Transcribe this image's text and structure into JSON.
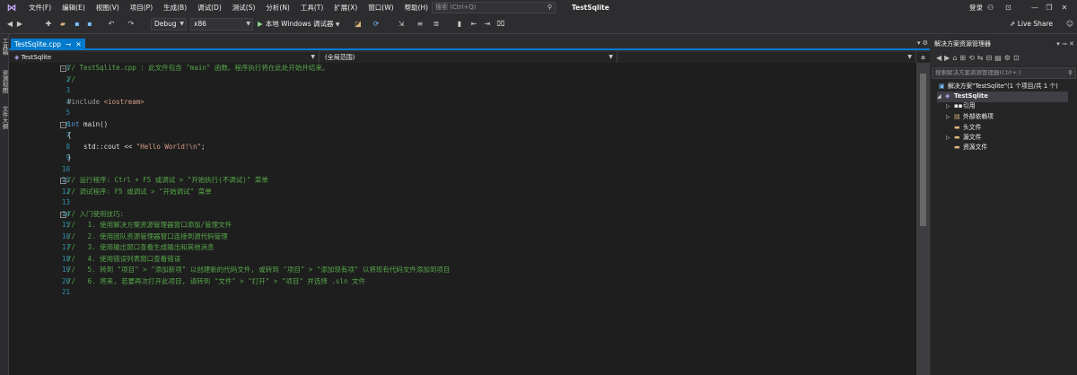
{
  "menu": {
    "items": [
      "文件(F)",
      "编辑(E)",
      "视图(V)",
      "项目(P)",
      "生成(B)",
      "调试(D)",
      "测试(S)",
      "分析(N)",
      "工具(T)",
      "扩展(X)",
      "窗口(W)",
      "帮助(H)"
    ],
    "search_placeholder": "搜索 (Ctrl+Q)",
    "window_title": "TestSqlite",
    "login": "登录"
  },
  "toolbar": {
    "config": "Debug",
    "platform": "x86",
    "start_label": "本地 Windows 调试器",
    "liveshare": "Live Share"
  },
  "left_strip": [
    "工具箱",
    "资源视图",
    "文件大纲"
  ],
  "editor": {
    "tab_label": "TestSqlite.cpp",
    "nav_project": "TestSqlite",
    "nav_scope": "(全局范围)",
    "line_numbers": [
      "1",
      "2",
      "3",
      "4",
      "5",
      "6",
      "7",
      "8",
      "9",
      "10",
      "11",
      "12",
      "13",
      "14",
      "15",
      "16",
      "17",
      "18",
      "19",
      "20",
      "21"
    ],
    "lines": [
      [
        {
          "c": "cmt",
          "t": "// TestSqlite.cpp : 此文件包含 \"main\" 函数。程序执行将在此处开始并结束。"
        }
      ],
      [
        {
          "c": "cmt",
          "t": "//"
        }
      ],
      [
        {
          "c": "txt",
          "t": ""
        }
      ],
      [
        {
          "c": "pp",
          "t": "#include "
        },
        {
          "c": "str",
          "t": "<iostream>"
        }
      ],
      [
        {
          "c": "txt",
          "t": ""
        }
      ],
      [
        {
          "c": "kw",
          "t": "int"
        },
        {
          "c": "txt",
          "t": " main()"
        }
      ],
      [
        {
          "c": "txt",
          "t": "{"
        }
      ],
      [
        {
          "c": "txt",
          "t": "    std::cout << "
        },
        {
          "c": "str",
          "t": "\"Hello World!\\n\""
        },
        {
          "c": "txt",
          "t": ";"
        }
      ],
      [
        {
          "c": "txt",
          "t": "}"
        }
      ],
      [
        {
          "c": "txt",
          "t": ""
        }
      ],
      [
        {
          "c": "cmt",
          "t": "// 运行程序: Ctrl + F5 或调试 > \"开始执行(不调试)\" 菜单"
        }
      ],
      [
        {
          "c": "cmt",
          "t": "// 调试程序: F5 或调试 > \"开始调试\" 菜单"
        }
      ],
      [
        {
          "c": "txt",
          "t": ""
        }
      ],
      [
        {
          "c": "cmt",
          "t": "// 入门使用技巧:"
        }
      ],
      [
        {
          "c": "cmt",
          "t": "//   1. 使用解决方案资源管理器窗口添加/管理文件"
        }
      ],
      [
        {
          "c": "cmt",
          "t": "//   2. 使用团队资源管理器窗口连接到源代码管理"
        }
      ],
      [
        {
          "c": "cmt",
          "t": "//   3. 使用输出窗口查看生成输出和其他消息"
        }
      ],
      [
        {
          "c": "cmt",
          "t": "//   4. 使用错误列表窗口查看错误"
        }
      ],
      [
        {
          "c": "cmt",
          "t": "//   5. 转到 \"项目\" > \"添加新项\" 以创建新的代码文件, 或转到 \"项目\" > \"添加现有项\" 以将现有代码文件添加到项目"
        }
      ],
      [
        {
          "c": "cmt",
          "t": "//   6. 将来, 若要再次打开此项目, 请转到 \"文件\" > \"打开\" > \"项目\" 并选择 .sln 文件"
        }
      ],
      [
        {
          "c": "txt",
          "t": ""
        }
      ]
    ]
  },
  "solution_explorer": {
    "title": "解决方案资源管理器",
    "search_placeholder": "搜索解决方案资源管理器(Ctrl+;)",
    "solution_label": "解决方案\"TestSqlite\"(1 个项目/共 1 个)",
    "project_label": "TestSqlite",
    "items": [
      "引用",
      "外部依赖项",
      "头文件",
      "源文件",
      "资源文件"
    ]
  }
}
